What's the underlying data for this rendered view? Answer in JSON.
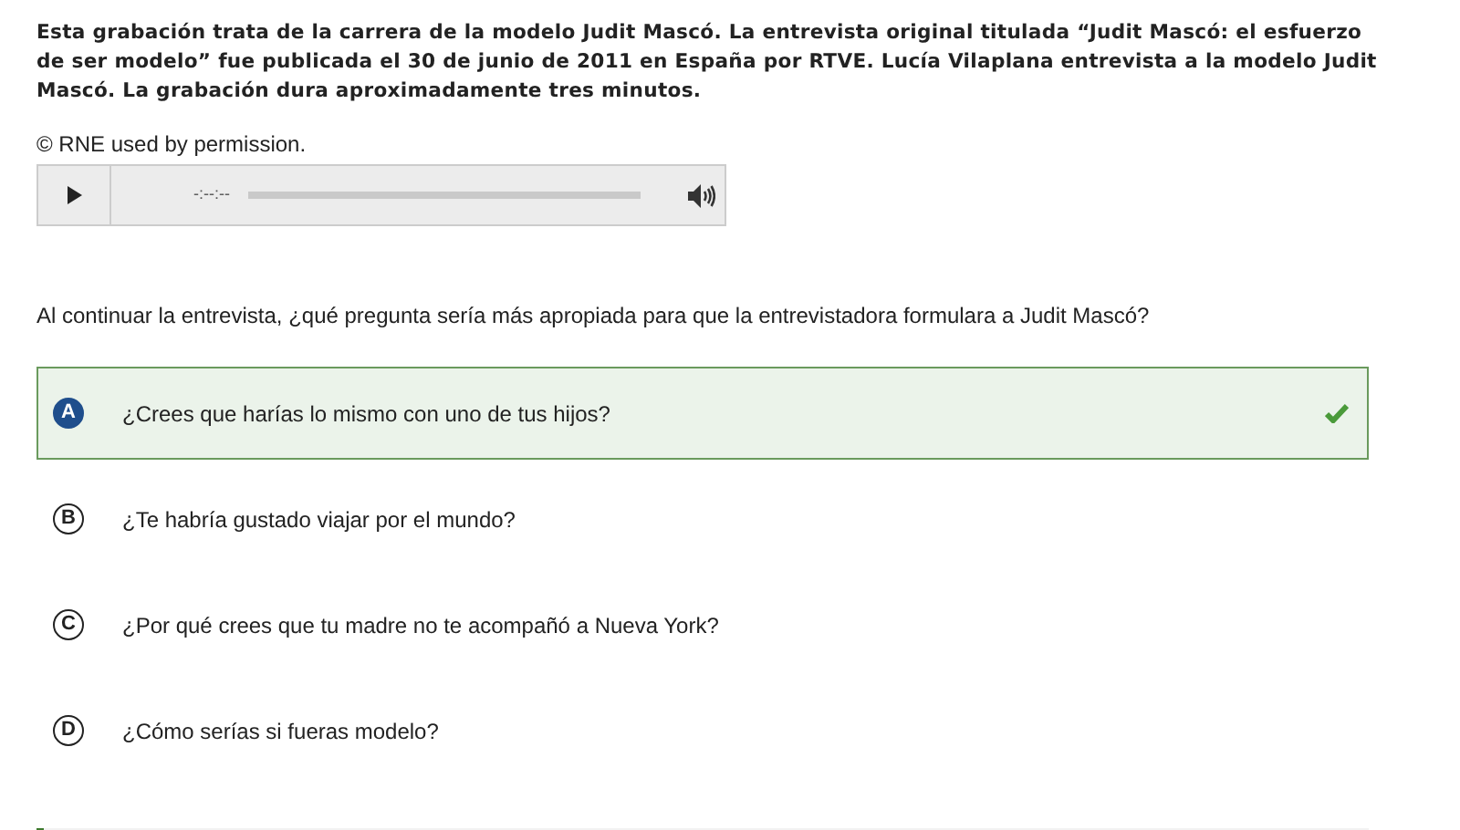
{
  "intro": "Esta grabación trata de la carrera de la modelo Judit Mascó. La entrevista original titulada “Judit Mascó: el esfuerzo de ser modelo” fue publicada el 30 de junio de 2011 en España por RTVE. Lucía Vilaplana entrevista a la modelo Judit Mascó. La grabación dura aproximadamente tres minutos.",
  "credit": "© RNE used by permission.",
  "player": {
    "time": "-:--:--"
  },
  "question": "Al continuar la entrevista, ¿qué pregunta sería más apropiada para que la entrevistadora formulara a Judit Mascó?",
  "options": [
    {
      "letter": "A",
      "text": "¿Crees que harías lo mismo con uno de tus hijos?",
      "selected": true,
      "correct": true
    },
    {
      "letter": "B",
      "text": "¿Te habría gustado viajar por el mundo?",
      "selected": false,
      "correct": false
    },
    {
      "letter": "C",
      "text": "¿Por qué crees que tu madre no te acompañó a Nueva York?",
      "selected": false,
      "correct": false
    },
    {
      "letter": "D",
      "text": "¿Cómo serías si fueras modelo?",
      "selected": false,
      "correct": false
    }
  ]
}
